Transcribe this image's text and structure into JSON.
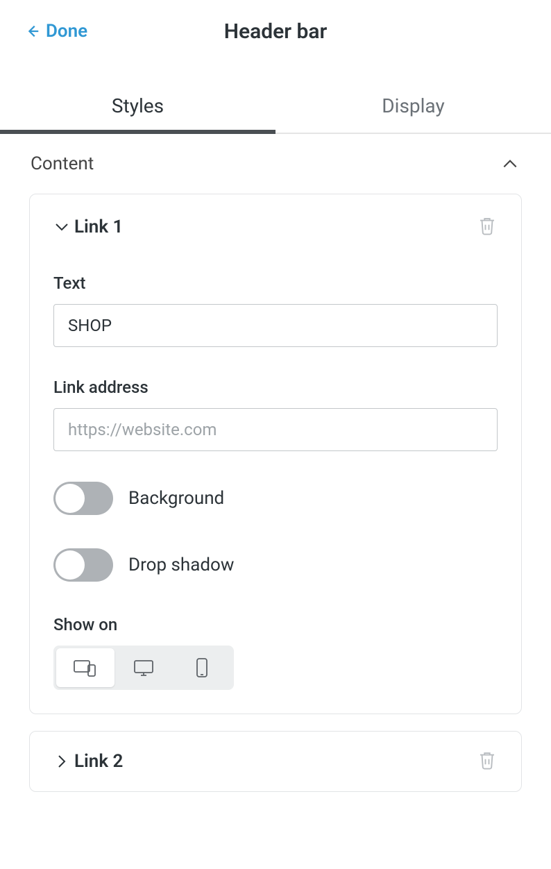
{
  "header": {
    "back_label": "Done",
    "title": "Header bar"
  },
  "tabs": {
    "styles": "Styles",
    "display": "Display"
  },
  "section": {
    "content_label": "Content"
  },
  "link1": {
    "title": "Link 1",
    "text_label": "Text",
    "text_value": "SHOP",
    "link_label": "Link address",
    "link_placeholder": "https://website.com",
    "background_label": "Background",
    "drop_shadow_label": "Drop shadow",
    "show_on_label": "Show on"
  },
  "link2": {
    "title": "Link 2"
  }
}
